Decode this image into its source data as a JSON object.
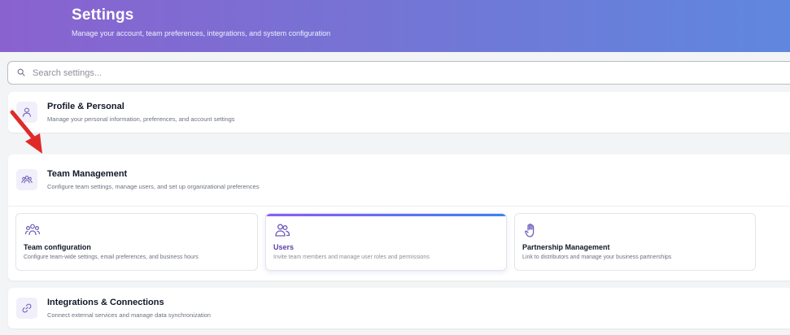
{
  "header": {
    "title": "Settings",
    "subtitle": "Manage your account, team preferences, integrations, and system configuration"
  },
  "search": {
    "placeholder": "Search settings..."
  },
  "sections": {
    "profile": {
      "title": "Profile & Personal",
      "description": "Manage your personal information, preferences, and account settings",
      "icon": "user-icon"
    },
    "team": {
      "title": "Team Management",
      "description": "Configure team settings, manage users, and set up organizational preferences",
      "icon": "users-group-icon",
      "items": [
        {
          "title": "Team configuration",
          "description": "Configure team-wide settings, email preferences, and business hours",
          "icon": "team-config-icon"
        },
        {
          "title": "Users",
          "description": "Invite team members and manage user roles and permissions",
          "icon": "users-icon",
          "active": true
        },
        {
          "title": "Partnership Management",
          "description": "Link to distributors and manage your business partnerships",
          "icon": "hand-icon"
        }
      ]
    },
    "integrations": {
      "title": "Integrations & Connections",
      "description": "Connect external services and manage data synchronization",
      "icon": "link-icon"
    }
  },
  "colors": {
    "accent": "#7c5cd6",
    "arrow": "#e02a2a"
  }
}
